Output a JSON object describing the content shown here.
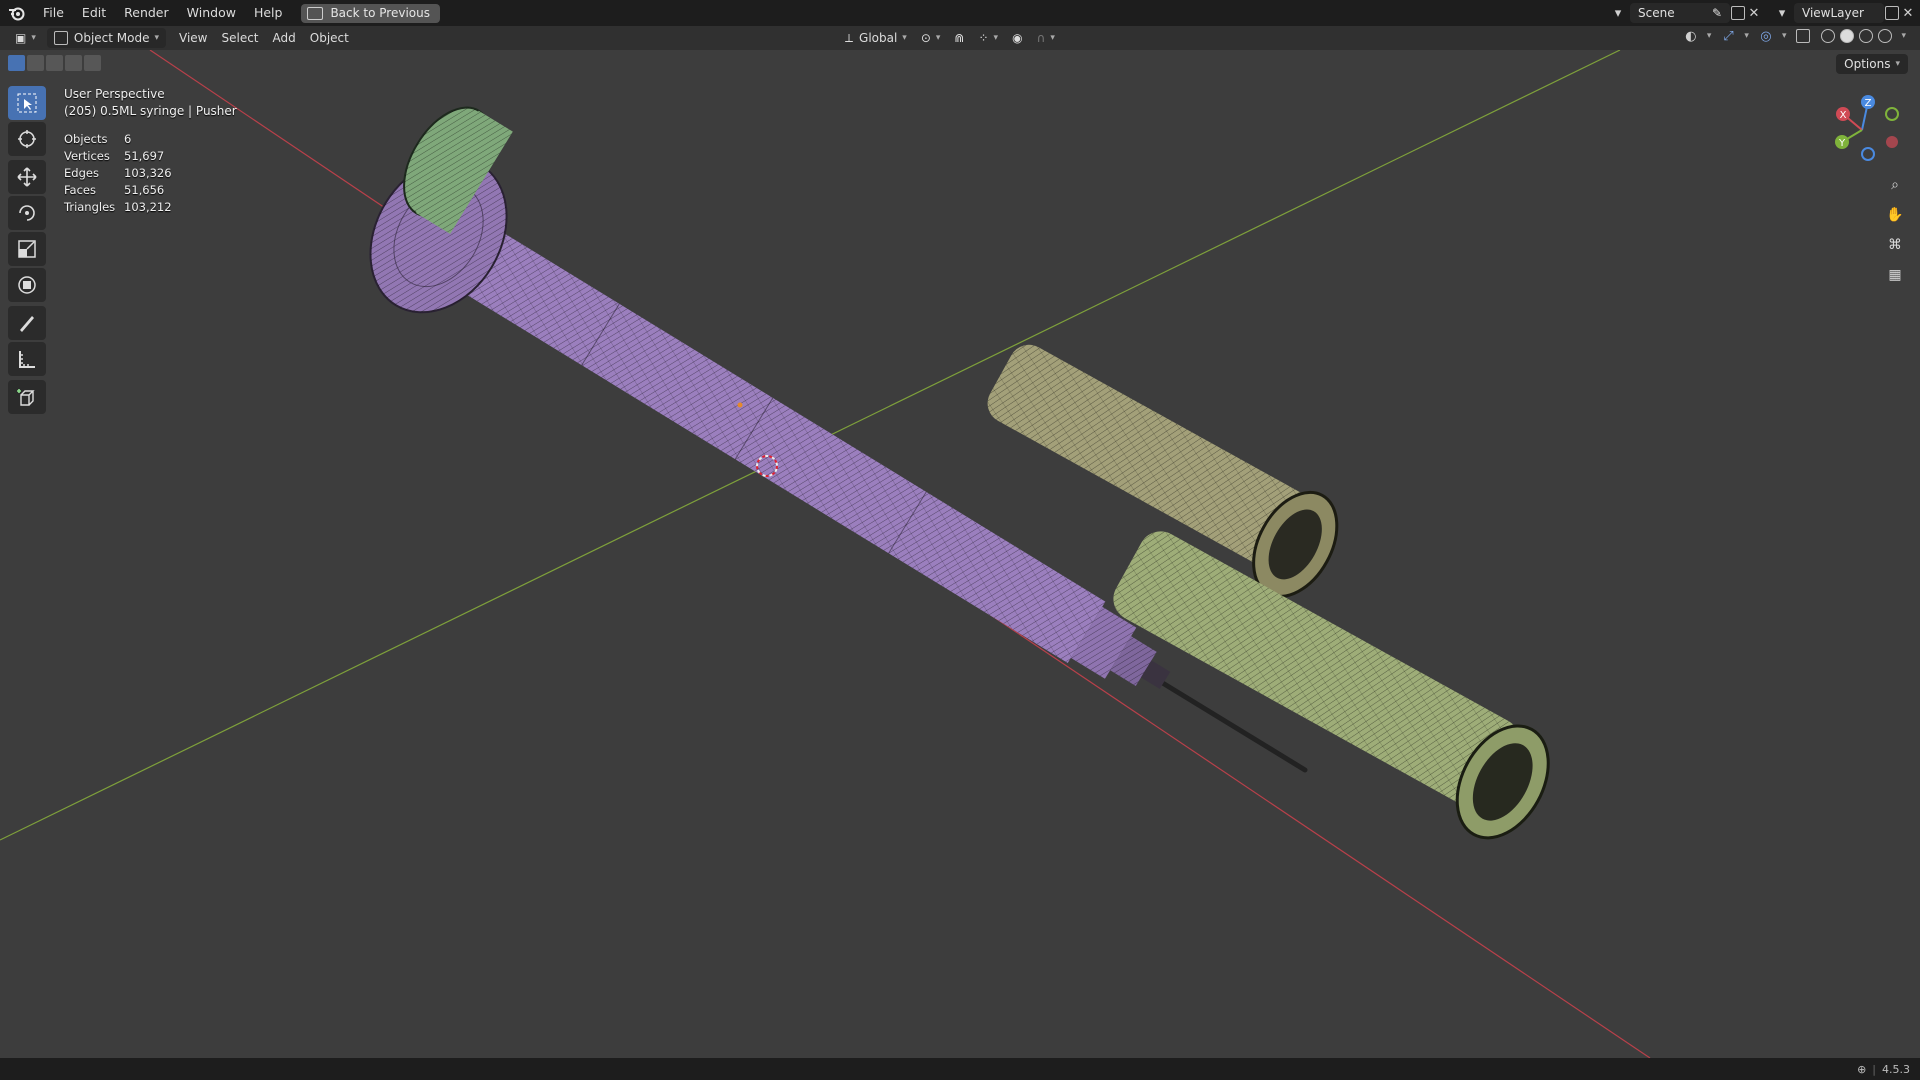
{
  "menu": {
    "file": "File",
    "edit": "Edit",
    "render": "Render",
    "window": "Window",
    "help": "Help",
    "back_to_previous": "Back to Previous"
  },
  "top_right": {
    "scene": "Scene",
    "view_layer": "ViewLayer"
  },
  "header": {
    "mode": "Object Mode",
    "view": "View",
    "select": "Select",
    "add": "Add",
    "object": "Object",
    "transform_orientation": "Global",
    "options": "Options"
  },
  "overlay": {
    "perspective": "User Perspective",
    "active_object": "(205) 0.5ML syringe | Pusher",
    "stats": [
      {
        "label": "Objects",
        "value": "6"
      },
      {
        "label": "Vertices",
        "value": "51,697"
      },
      {
        "label": "Edges",
        "value": "103,326"
      },
      {
        "label": "Faces",
        "value": "51,656"
      },
      {
        "label": "Triangles",
        "value": "103,212"
      }
    ]
  },
  "gizmo": {
    "x": "X",
    "y": "Y",
    "z": "Z"
  },
  "status": {
    "version": "4.5.3"
  },
  "colors": {
    "bg": "#3d3d3d",
    "axis_x": "#b8404a",
    "axis_y": "#7ea03b",
    "accent": "#4772b3",
    "plunger": "#9b7fbe",
    "barrel_cap": "#a3a079",
    "needle_cap": "#9ead78",
    "green_part": "#7fa87a"
  }
}
